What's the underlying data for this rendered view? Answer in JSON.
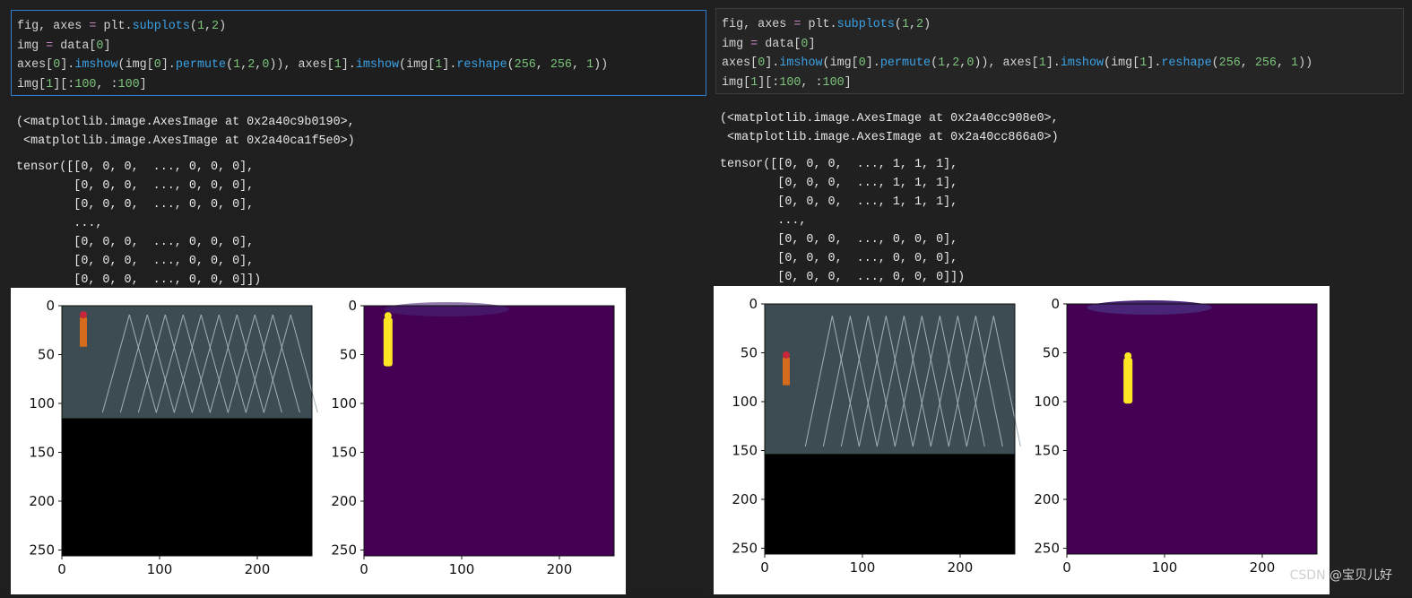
{
  "left": {
    "code": [
      "fig, axes = plt.subplots(1,2)",
      "img = data[0]",
      "axes[0].imshow(img[0].permute(1,2,0)), axes[1].imshow(img[1].reshape(256, 256, 1))",
      "img[1][:100, :100]"
    ],
    "output_repr": "(<matplotlib.image.AxesImage at 0x2a40c9b0190>,\n <matplotlib.image.AxesImage at 0x2a40ca1f5e0>)",
    "output_tensor": "tensor([[0, 0, 0,  ..., 0, 0, 0],\n        [0, 0, 0,  ..., 0, 0, 0],\n        [0, 0, 0,  ..., 0, 0, 0],\n        ...,\n        [0, 0, 0,  ..., 0, 0, 0],\n        [0, 0, 0,  ..., 0, 0, 0],\n        [0, 0, 0,  ..., 0, 0, 0]])",
    "yticks": [
      "0",
      "50",
      "100",
      "150",
      "200",
      "250"
    ],
    "xticks": [
      "0",
      "100",
      "200"
    ],
    "photo_height_fraction": 0.45,
    "mask_blob_y": [
      12,
      62
    ]
  },
  "right": {
    "code": [
      "fig, axes = plt.subplots(1,2)",
      "img = data[0]",
      "axes[0].imshow(img[0].permute(1,2,0)), axes[1].imshow(img[1].reshape(256, 256, 1))",
      "img[1][:100, :100]"
    ],
    "output_repr": "(<matplotlib.image.AxesImage at 0x2a40cc908e0>,\n <matplotlib.image.AxesImage at 0x2a40cc866a0>)",
    "output_tensor": "tensor([[0, 0, 0,  ..., 1, 1, 1],\n        [0, 0, 0,  ..., 1, 1, 1],\n        [0, 0, 0,  ..., 1, 1, 1],\n        ...,\n        [0, 0, 0,  ..., 0, 0, 0],\n        [0, 0, 0,  ..., 0, 0, 0],\n        [0, 0, 0,  ..., 0, 0, 0]])",
    "yticks": [
      "0",
      "50",
      "100",
      "150",
      "200",
      "250"
    ],
    "xticks": [
      "0",
      "100",
      "200"
    ],
    "photo_height_fraction": 0.6,
    "mask_blob_y": [
      55,
      102
    ]
  },
  "watermark": "CSDN @宝贝儿好",
  "colors": {
    "mask_bg": "#440154",
    "mask_fg": "#fde725",
    "mask_mid": "#482576",
    "photo": "#3d4c52"
  }
}
